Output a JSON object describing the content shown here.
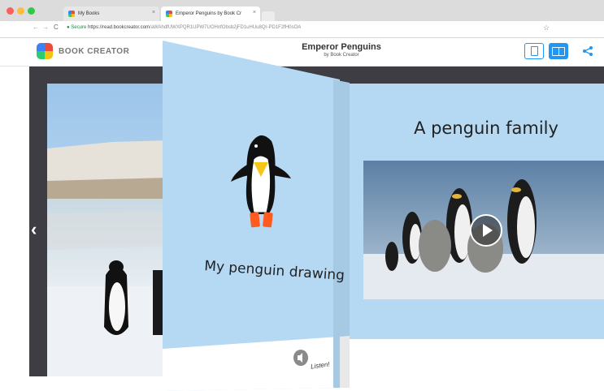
{
  "browser": {
    "tabs": [
      {
        "label": "My Books",
        "close": "×"
      },
      {
        "label": "Emperor Penguins by Book Cr",
        "close": "×"
      }
    ],
    "nav": {
      "back": "←",
      "forward": "→",
      "reload": "C"
    },
    "url": {
      "secure_label": "Secure",
      "host": "https://read.bookcreator.com",
      "path": "/aWAhdfUWXPQR1UPW7UOHnfObsb2jFD1uHUu8Qr-PD1F2fH0sOA"
    },
    "star": "☆"
  },
  "app": {
    "brand": "BOOK CREATOR",
    "book_title": "Emperor Penguins",
    "book_subtitle": "by Book Creator"
  },
  "pages": {
    "flip_page_caption": "My penguin drawing",
    "right_page_title": "A penguin family",
    "listen_label": "Listen!"
  },
  "icons": {
    "prev": "‹",
    "play": "play-icon",
    "speaker": "speaker-icon",
    "share": "share-icon",
    "single_page_view": "single-page-icon",
    "double_page_view": "double-page-icon"
  },
  "colors": {
    "accent": "#2196f3",
    "page_blue": "#b5d8f3",
    "stage": "#3d3d43"
  }
}
